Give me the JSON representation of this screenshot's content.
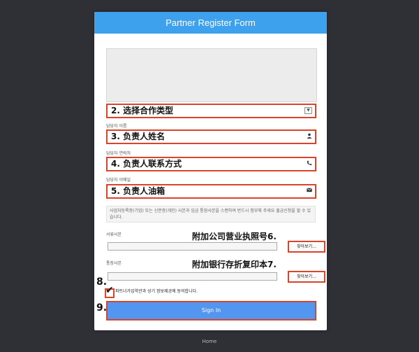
{
  "form": {
    "title": "Partner Register Form",
    "select_type_annotation": "2. 选择合作类型",
    "manager_name_label": "담당자 이름",
    "manager_name_annotation": "3. 负责人姓名",
    "manager_contact_label": "담당자 연락처",
    "manager_contact_annotation": "4. 负责人联系方式",
    "manager_email_label": "담당자 이메일",
    "manager_email_annotation": "5. 负责人油箱",
    "notice_text": "사업자등록증(기업) 또는 신분증(개인) 사본과 입금 통장사본을 스캔하여 반드시 첨부해 주세요\n출금신청을 할 수 있습니다.",
    "document_copy_label": "서류사본",
    "document_copy_annotation": "附加公司营业执照号6.",
    "bankbook_copy_label": "통장사본",
    "bankbook_copy_annotation": "附加银行存折复印本7.",
    "find_button_label": "찾아보기...",
    "agree_text": "파트너가입약관과 상기 정보제공에 동의합니다.",
    "agree_annotation": "8.",
    "submit_annotation": "9.",
    "submit_label": "Sign In"
  },
  "footer": {
    "home_link": "Home"
  },
  "icons": {
    "select": "chevron-down-icon",
    "name": "person-icon",
    "contact": "phone-icon",
    "email": "envelope-icon"
  },
  "colors": {
    "header": "#3ea1ee",
    "highlight": "#d9442b",
    "submit": "#5296f0",
    "background": "#2f3036"
  }
}
